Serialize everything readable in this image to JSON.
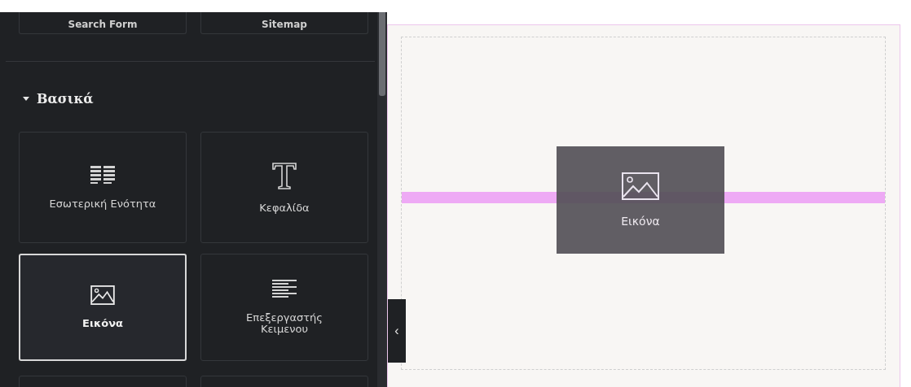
{
  "panel": {
    "top_cards": [
      {
        "label": "Search Form"
      },
      {
        "label": "Sitemap"
      }
    ],
    "category": {
      "title": "Βασικά",
      "expanded": true
    },
    "widgets": [
      {
        "label": "Εσωτερική Ενότητα",
        "kind": "inner-section",
        "selected": false
      },
      {
        "label": "Κεφαλίδα",
        "kind": "heading",
        "selected": false
      },
      {
        "label": "Εικόνα",
        "kind": "image",
        "selected": true
      },
      {
        "label": "Επεξεργαστής Κειμενου",
        "kind": "text-editor",
        "selected": false
      }
    ]
  },
  "collapse_toggle": {
    "glyph": "‹"
  },
  "canvas": {
    "drag_preview": {
      "label": "Εικόνα",
      "kind": "image"
    }
  }
}
